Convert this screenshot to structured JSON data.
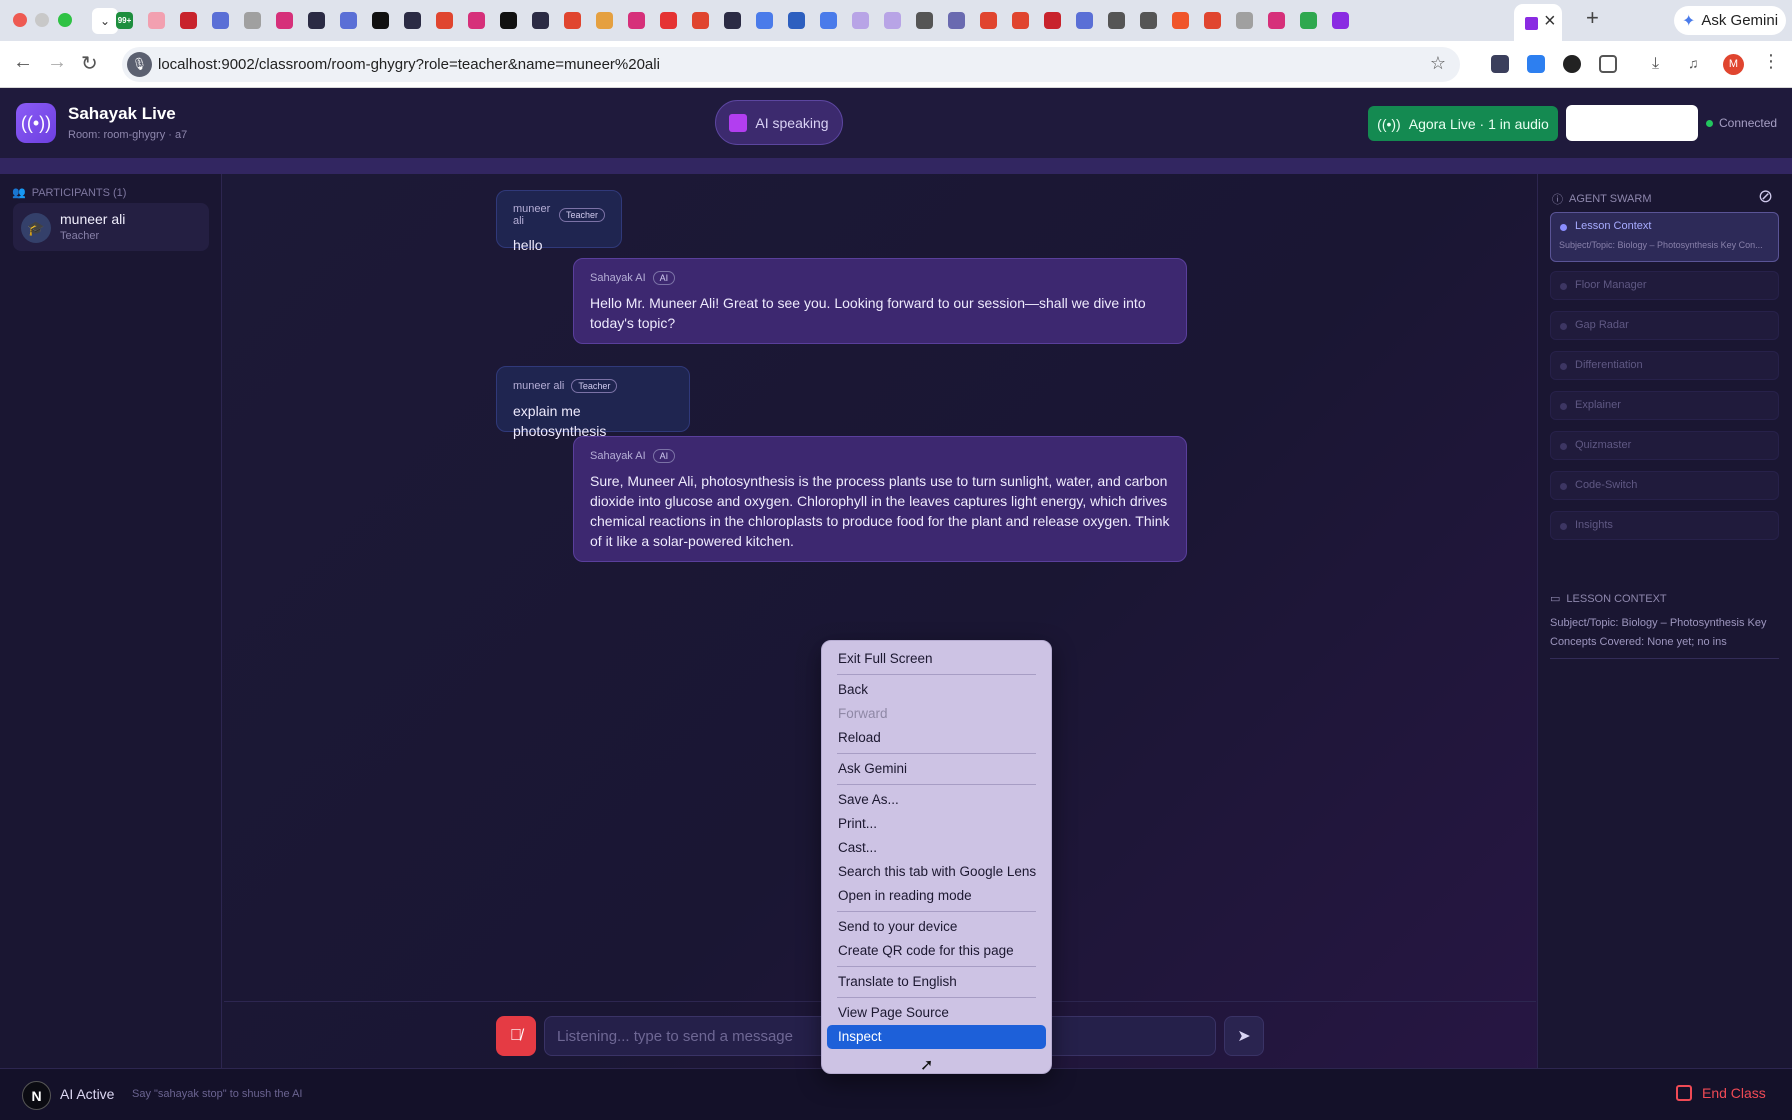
{
  "browser": {
    "url": "localhost:9002/classroom/room-ghygry?role=teacher&name=muneer%20ali",
    "ask_gemini": "Ask Gemini",
    "profile_initial": "M",
    "notification_count": "99+"
  },
  "header": {
    "app_title": "Sahayak Live",
    "room": "Room: room-ghygry · a7",
    "ai_status": "AI speaking",
    "agora": "Agora Live · 1 in audio",
    "connection": "Connected"
  },
  "participants": {
    "heading": "PARTICIPANTS (1)",
    "items": [
      {
        "name": "muneer ali",
        "role": "Teacher"
      }
    ]
  },
  "messages": [
    {
      "sender": "muneer ali",
      "badge": "Teacher",
      "text": "hello"
    },
    {
      "sender": "Sahayak AI",
      "badge": "AI",
      "text": "Hello Mr. Muneer Ali! Great to see you. Looking forward to our session—shall we dive into today's topic?"
    },
    {
      "sender": "muneer ali",
      "badge": "Teacher",
      "text": "explain me photosynthesis"
    },
    {
      "sender": "Sahayak AI",
      "badge": "AI",
      "text": "Sure, Muneer Ali, photosynthesis is the process plants use to turn sunlight, water, and carbon dioxide into glucose and oxygen. Chlorophyll in the leaves captures light energy, which drives chemical reactions in the chloroplasts to produce food for the plant and release oxygen. Think of it like a solar-powered kitchen."
    }
  ],
  "agent_swarm": {
    "heading": "AGENT SWARM",
    "active_subtitle": "Subject/Topic: Biology – Photosynthesis Key Con...",
    "agents": [
      "Lesson Context",
      "Floor Manager",
      "Gap Radar",
      "Differentiation",
      "Explainer",
      "Quizmaster",
      "Code-Switch",
      "Insights"
    ]
  },
  "lesson_context": {
    "heading": "LESSON CONTEXT",
    "text": "Subject/Topic: Biology – Photosynthesis Key Concepts Covered: None yet; no ins"
  },
  "composer": {
    "placeholder": "Listening... type to send a message"
  },
  "footer": {
    "badge": "N",
    "ai_active": "AI Active",
    "hint": "Say \"sahayak stop\" to shush the AI",
    "end_class": "End Class"
  },
  "context_menu": {
    "items": [
      "Exit Full Screen",
      "Back",
      "Forward",
      "Reload",
      "Ask Gemini",
      "Save As...",
      "Print...",
      "Cast...",
      "Search this tab with Google Lens",
      "Open in reading mode",
      "Send to your device",
      "Create QR code for this page",
      "Translate to English",
      "View Page Source",
      "Inspect"
    ]
  },
  "colors": {
    "accent": "#8b5cf6",
    "agora_green": "#148a51",
    "end_class_red": "#f04a55",
    "menu_highlight": "#1d60d9"
  }
}
